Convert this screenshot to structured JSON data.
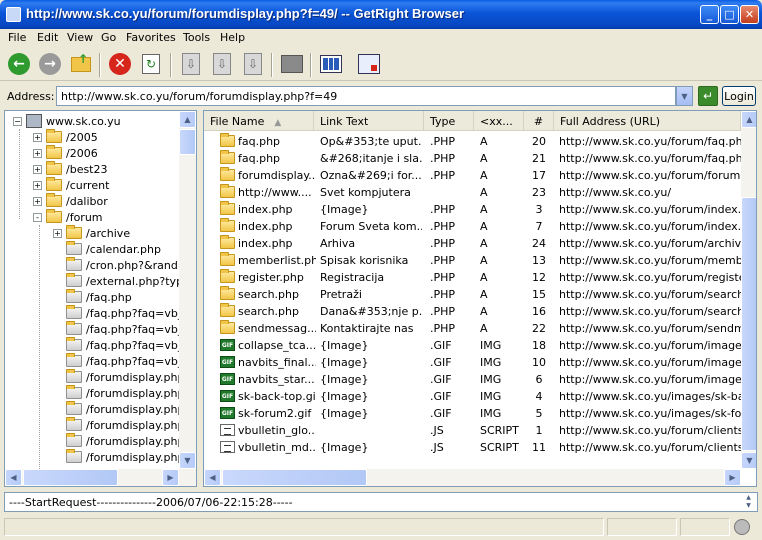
{
  "window": {
    "title": "http://www.sk.co.yu/forum/forumdisplay.php?f=49/  --  GetRight Browser",
    "minimize": "_",
    "maximize": "□",
    "close": "✕"
  },
  "menu": [
    "File",
    "Edit",
    "View",
    "Go",
    "Favorites",
    "Tools",
    "Help"
  ],
  "toolbar": {
    "icons": [
      "back-icon",
      "forward-icon",
      "up-folder-icon",
      "stop-icon",
      "refresh-icon",
      "download-icon",
      "download-all-icon",
      "download-selected-icon",
      "properties-icon",
      "view-icon",
      "options-icon"
    ]
  },
  "address": {
    "label": "Address:",
    "value": "http://www.sk.co.yu/forum/forumdisplay.php?f=49",
    "login": "Login"
  },
  "tree": {
    "root": "www.sk.co.yu",
    "items": [
      {
        "label": "/2005",
        "expander": "+"
      },
      {
        "label": "/2006",
        "expander": "+"
      },
      {
        "label": "/best23",
        "expander": "+"
      },
      {
        "label": "/current",
        "expander": "+"
      },
      {
        "label": "/dalibor",
        "expander": "+"
      },
      {
        "label": "/forum",
        "expander": "-"
      }
    ],
    "children": [
      {
        "label": "/archive",
        "expander": "+"
      },
      {
        "label": "/calendar.php",
        "expander": ""
      },
      {
        "label": "/cron.php?&rand=",
        "expander": ""
      },
      {
        "label": "/external.php?type",
        "expander": ""
      },
      {
        "label": "/faq.php",
        "expander": ""
      },
      {
        "label": "/faq.php?faq=vb_",
        "expander": ""
      },
      {
        "label": "/faq.php?faq=vb_",
        "expander": ""
      },
      {
        "label": "/faq.php?faq=vb_",
        "expander": ""
      },
      {
        "label": "/faq.php?faq=vb_",
        "expander": ""
      },
      {
        "label": "/forumdisplay.php?",
        "expander": ""
      },
      {
        "label": "/forumdisplay.php?",
        "expander": ""
      },
      {
        "label": "/forumdisplay.php?",
        "expander": ""
      },
      {
        "label": "/forumdisplay.php?",
        "expander": ""
      },
      {
        "label": "/forumdisplay.php?",
        "expander": ""
      },
      {
        "label": "/forumdisplay.php?",
        "expander": ""
      }
    ]
  },
  "list": {
    "columns": [
      "File Name",
      "Link Text",
      "Type",
      "<xx...",
      "#",
      "Full Address (URL)"
    ],
    "rows": [
      {
        "icon": "folder",
        "name": "faq.php",
        "link": "Op&#353;te uput...",
        "type": ".PHP",
        "tag": "A",
        "num": "20",
        "url": "http://www.sk.co.yu/forum/faq.php?"
      },
      {
        "icon": "folder",
        "name": "faq.php",
        "link": "&#268;itanje i sla...",
        "type": ".PHP",
        "tag": "A",
        "num": "21",
        "url": "http://www.sk.co.yu/forum/faq.php?"
      },
      {
        "icon": "folder",
        "name": "forumdisplay....",
        "link": "Ozna&#269;i for...",
        "type": ".PHP",
        "tag": "A",
        "num": "17",
        "url": "http://www.sk.co.yu/forum/forumdisp"
      },
      {
        "icon": "folder",
        "name": "http://www....",
        "link": "Svet kompjutera",
        "type": "",
        "tag": "A",
        "num": "23",
        "url": "http://www.sk.co.yu/"
      },
      {
        "icon": "folder",
        "name": "index.php",
        "link": "{Image}",
        "type": ".PHP",
        "tag": "A",
        "num": "3",
        "url": "http://www.sk.co.yu/forum/index.php"
      },
      {
        "icon": "folder",
        "name": "index.php",
        "link": "Forum Sveta kom...",
        "type": ".PHP",
        "tag": "A",
        "num": "7",
        "url": "http://www.sk.co.yu/forum/index.php"
      },
      {
        "icon": "folder",
        "name": "index.php",
        "link": "Arhiva",
        "type": ".PHP",
        "tag": "A",
        "num": "24",
        "url": "http://www.sk.co.yu/forum/archive/in"
      },
      {
        "icon": "folder",
        "name": "memberlist.php",
        "link": "Spisak korisnika",
        "type": ".PHP",
        "tag": "A",
        "num": "13",
        "url": "http://www.sk.co.yu/forum/memberlis"
      },
      {
        "icon": "folder",
        "name": "register.php",
        "link": "Registracija",
        "type": ".PHP",
        "tag": "A",
        "num": "12",
        "url": "http://www.sk.co.yu/forum/register.p"
      },
      {
        "icon": "folder",
        "name": "search.php",
        "link": "Pretraži",
        "type": ".PHP",
        "tag": "A",
        "num": "15",
        "url": "http://www.sk.co.yu/forum/search.ph"
      },
      {
        "icon": "folder",
        "name": "search.php",
        "link": "Dana&#353;nje p...",
        "type": ".PHP",
        "tag": "A",
        "num": "16",
        "url": "http://www.sk.co.yu/forum/search.ph"
      },
      {
        "icon": "folder",
        "name": "sendmessag...",
        "link": "Kontaktirajte nas",
        "type": ".PHP",
        "tag": "A",
        "num": "22",
        "url": "http://www.sk.co.yu/forum/sendmess"
      },
      {
        "icon": "gif",
        "name": "collapse_tca...",
        "link": "{Image}",
        "type": ".GIF",
        "tag": "IMG",
        "num": "18",
        "url": "http://www.sk.co.yu/forum/images/b"
      },
      {
        "icon": "gif",
        "name": "navbits_final...",
        "link": "{Image}",
        "type": ".GIF",
        "tag": "IMG",
        "num": "10",
        "url": "http://www.sk.co.yu/forum/images/m"
      },
      {
        "icon": "gif",
        "name": "navbits_star...",
        "link": "{Image}",
        "type": ".GIF",
        "tag": "IMG",
        "num": "6",
        "url": "http://www.sk.co.yu/forum/images/m"
      },
      {
        "icon": "gif",
        "name": "sk-back-top.gif",
        "link": "{Image}",
        "type": ".GIF",
        "tag": "IMG",
        "num": "4",
        "url": "http://www.sk.co.yu/images/sk-back-"
      },
      {
        "icon": "gif",
        "name": "sk-forum2.gif",
        "link": "{Image}",
        "type": ".GIF",
        "tag": "IMG",
        "num": "5",
        "url": "http://www.sk.co.yu/images/sk-forum"
      },
      {
        "icon": "js",
        "name": "vbulletin_glo...",
        "link": "",
        "type": ".JS",
        "tag": "SCRIPT",
        "num": "1",
        "url": "http://www.sk.co.yu/forum/clientscrip"
      },
      {
        "icon": "js",
        "name": "vbulletin_md...",
        "link": "{Image}",
        "type": ".JS",
        "tag": "SCRIPT",
        "num": "11",
        "url": "http://www.sk.co.yu/forum/clientscrip"
      }
    ]
  },
  "log": {
    "text": "----StartRequest---------------2006/07/06-22:15:28-----"
  }
}
